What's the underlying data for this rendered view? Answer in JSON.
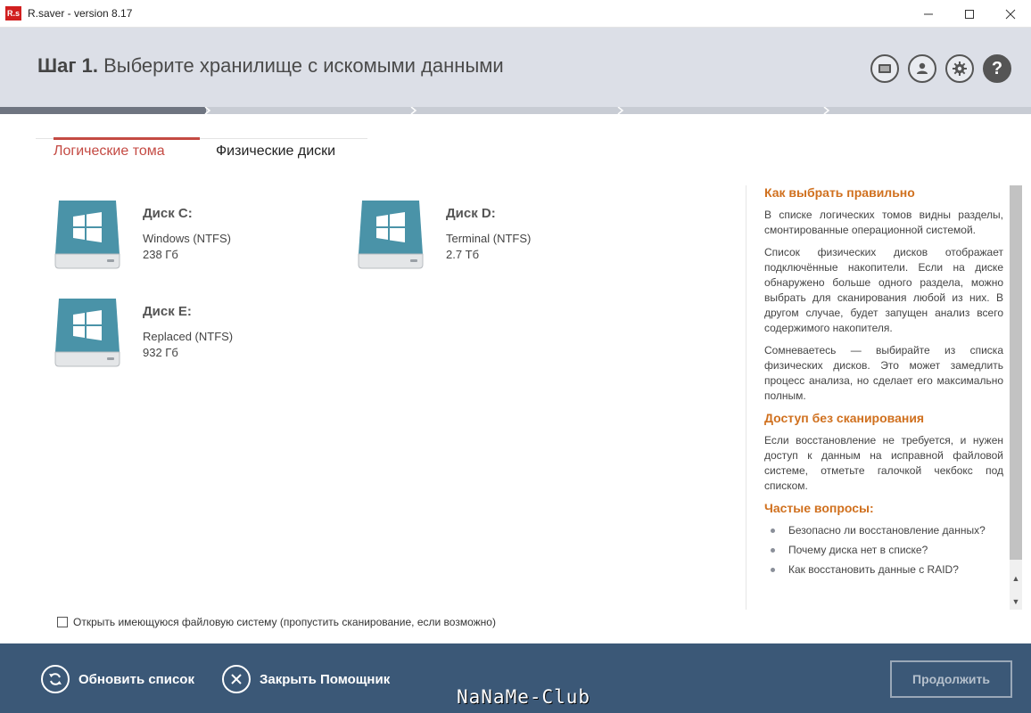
{
  "window": {
    "logo_text": "R.s",
    "title": "R.saver - version 8.17",
    "logo_color": "#d11f1f"
  },
  "header": {
    "step_number": "Шаг 1.",
    "step_title": "Выберите хранилище с искомыми данными",
    "icons": [
      "log-icon",
      "account-icon",
      "settings-icon",
      "help-icon"
    ],
    "help_label": "?"
  },
  "progress": {
    "steps": 5,
    "current": 1
  },
  "tabs": [
    {
      "label": "Логические тома",
      "active": true
    },
    {
      "label": "Физические диски",
      "active": false
    }
  ],
  "disks": [
    {
      "name": "Диск C:",
      "fs": "Windows (NTFS)",
      "size": "238 Гб"
    },
    {
      "name": "Диск D:",
      "fs": "Terminal (NTFS)",
      "size": "2.7 Тб"
    },
    {
      "name": "Диск E:",
      "fs": "Replaced (NTFS)",
      "size": "932 Гб"
    }
  ],
  "skip_scan": {
    "label": "Открыть имеющуюся файловую систему (пропустить сканирование, если возможно)",
    "checked": false
  },
  "help": {
    "heading1": "Как выбрать правильно",
    "p1": "В списке логических томов видны разделы, смонтированные операционной системой.",
    "p2": "Список физических дисков отображает подключённые накопители. Если на диске обнаружено больше одного раздела, можно выбрать для сканирования любой из них. В другом случае, будет запущен анализ всего содержимого накопителя.",
    "p3": "Сомневаетесь — выбирайте из списка физических дисков. Это может замедлить процесс анализа, но сделает его максимально полным.",
    "heading2": "Доступ без сканирования",
    "p4": "Если восстановление не требуется, и нужен доступ к данным на исправной файловой системе, отметьте галочкой чекбокс под списком.",
    "heading3": "Частые вопросы:",
    "faq": [
      "Безопасно ли восстановление данных?",
      "Почему диска нет в списке?",
      "Как восстановить данные с RAID?"
    ]
  },
  "footer": {
    "refresh_label": "Обновить список",
    "close_label": "Закрыть Помощник",
    "continue_label": "Продолжить",
    "watermark": "NaNaMe-Club"
  },
  "colors": {
    "accent": "#c44a43",
    "help_heading": "#d0701e",
    "footer_bg": "#3b5877",
    "header_bg": "#dcdfe7",
    "disk_teal": "#4a93a8"
  }
}
